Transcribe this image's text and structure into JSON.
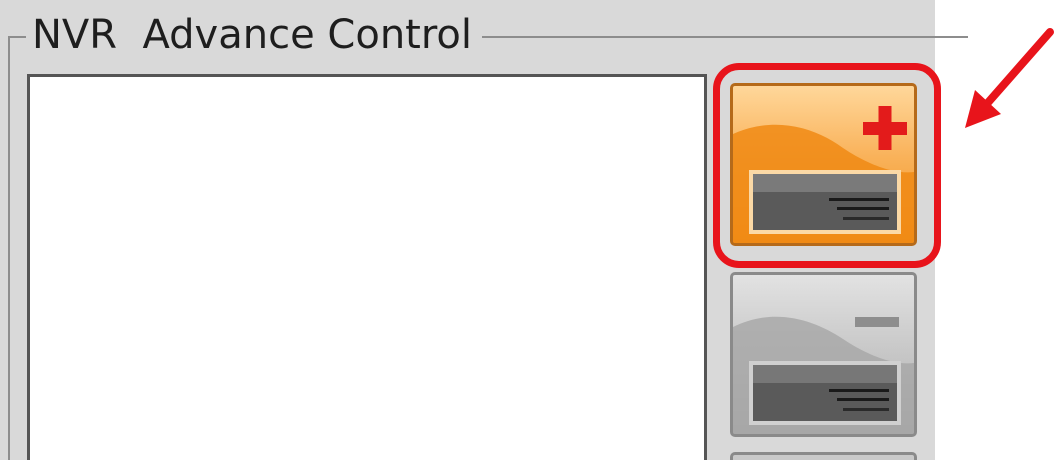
{
  "panel": {
    "title": "NVR  Advance Control"
  },
  "device_list": {
    "items": []
  },
  "toolbar": {
    "add_button": {
      "icon": "nvr-add-icon",
      "state": "highlighted"
    },
    "remove_button": {
      "icon": "nvr-remove-icon",
      "state": "normal"
    }
  },
  "annotation": {
    "color": "#e8141b",
    "target": "add_button"
  },
  "colors": {
    "panel_bg": "#d9d9d9",
    "add_accent": "#f28f1a",
    "plus_red": "#e31b1b"
  }
}
